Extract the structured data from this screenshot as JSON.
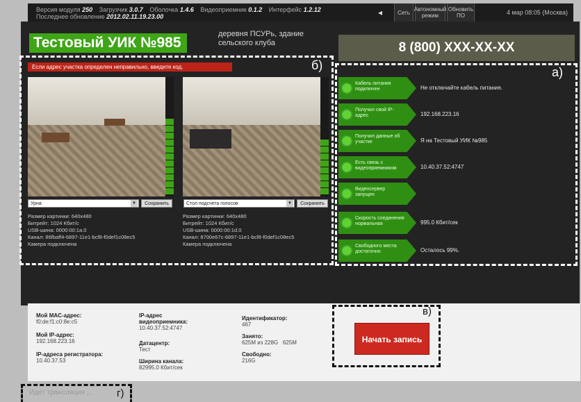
{
  "topbar": {
    "version_label": "Версия модуля",
    "version_value": "250",
    "firmware_label": "Загрузчик",
    "firmware_value": "3.0.7",
    "shell_label": "Оболочка",
    "shell_value": "1.4.6",
    "receiver_label": "Видеоприемник",
    "receiver_value": "0.1.2",
    "interface_label": "Интерфейс",
    "interface_value": "1.2.12",
    "last_update_label": "Последнее обновление",
    "last_update_value": "2012.02.11.19.23.00",
    "arrow": "◂",
    "btn_network": "Сеть",
    "btn_offline": "Автономный режим",
    "btn_update": "Обновить ПО",
    "datetime": "4 мар 08:05 (Москва)"
  },
  "header": {
    "title": "Тестовый УИК №985",
    "place": "деревня ПСУРь, здание сельского клуба",
    "phone": "8 (800) XXX-XX-XX"
  },
  "alert": "Если адрес участка определен неправильно, введите код.",
  "cameras": [
    {
      "selected": "Урна",
      "save_label": "Сохранить",
      "info": [
        "Размер картинки: 640х480",
        "Битрейт: 1024 Кбит/с",
        "USB-шина: 0000:00:1a.0",
        "Канал: 86fbaff4-6897-11e1-bcf8-f0def1c08ec5",
        "Камера подключена"
      ]
    },
    {
      "selected": "Стол подсчета голосов",
      "save_label": "Сохранить",
      "info": [
        "Размер картинки: 640х480",
        "Битрейт: 1024 Кбит/с",
        "USB-шина: 0000:00:1d.0",
        "Канал: 8700e67c-6897-11e1-bcf8-f0def1c08ec5",
        "Камера подключена"
      ]
    }
  ],
  "status": [
    {
      "label": "Кабель питания подключен",
      "value": "Не отключайте кабель питания."
    },
    {
      "label": "Получил свой IP-адрес",
      "value": "192.168.223.16"
    },
    {
      "label": "Получил данные об участке",
      "value": "Я на Тестовый УИК №985"
    },
    {
      "label": "Есть связь с видеоприемником",
      "value": "10.40.37.52:4747"
    },
    {
      "label": "Видеосервер запущен",
      "value": ""
    },
    {
      "label": "Скорость соединения нормальная",
      "value": "995.0 Кбит/сек"
    },
    {
      "label": "Свободного места достаточно",
      "value": "Осталось 99%."
    }
  ],
  "bottom": {
    "mac_label": "Мой MAC-адрес:",
    "mac_value": "f0:de:f1:c0:8e:c5",
    "ip_label": "Мой IP-адрес:",
    "ip_value": "192.168.223.16",
    "reg_label": "IP-адреса регистратора:",
    "reg_value": "10.40.37.53",
    "recv_label": "IP-адрес видеоприемника:",
    "recv_value": "10.40.37.52:4747",
    "dc_label": "Датацентр:",
    "dc_value": "Тест",
    "bw_label": "Ширина канала:",
    "bw_value": "82995.0 Кбит/сек",
    "id_label": "Идентификатор:",
    "id_value": "467",
    "used_label": "Занято:",
    "used_value": "625M из 228G",
    "used_extra": "625M",
    "free_label": "Свободно:",
    "free_value": "216G",
    "start_label": "Начать запись"
  },
  "broadcast": "Идет трансляция ...",
  "marks": {
    "a": "а)",
    "b": "б)",
    "v": "в)",
    "g": "г)"
  },
  "colors": {
    "accent_green": "#3fa517",
    "alert_red": "#bb2417",
    "start_red": "#cc2a20"
  }
}
